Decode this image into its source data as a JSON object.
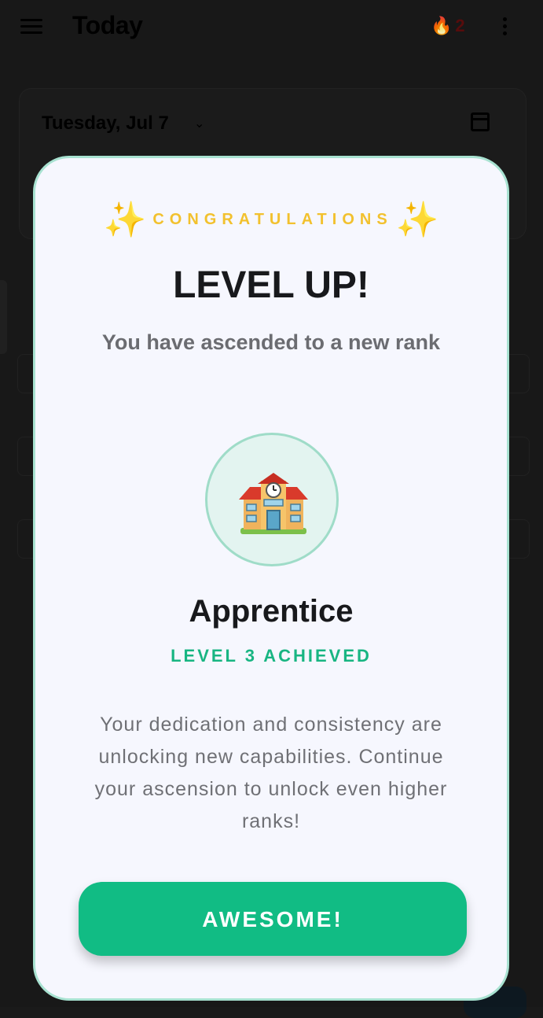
{
  "app": {
    "title": "Today",
    "streak_count": "2",
    "streak_icon": "flame-icon",
    "date_label": "Tuesday, Jul 7"
  },
  "modal": {
    "eyebrow": "CONGRATULATIONS",
    "sparkle_icon": "sparkles-icon",
    "title": "LEVEL UP!",
    "subtitle": "You have ascended to a new rank",
    "rank_icon": "school-building-icon",
    "rank_name": "Apprentice",
    "rank_level": "LEVEL 3 ACHIEVED",
    "description": "Your dedication and consistency are unlocking new capabilities. Continue your ascension to unlock even higher ranks!",
    "button_label": "AWESOME!",
    "colors": {
      "accent": "#11bc84",
      "gold": "#f2c12e",
      "border": "#a8e2d1",
      "background": "#f6f7fe"
    }
  }
}
